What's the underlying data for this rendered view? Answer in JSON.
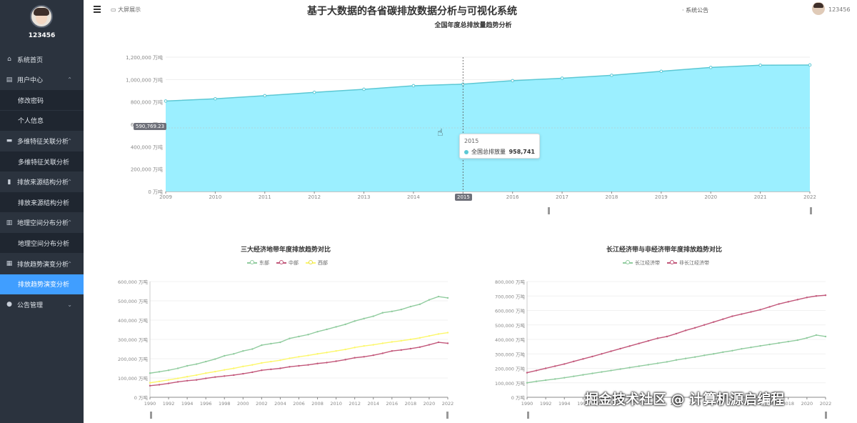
{
  "sidebar": {
    "user_name": "123456",
    "items": [
      {
        "label": "系统首页",
        "icon": "home-icon",
        "type": "top"
      },
      {
        "label": "用户中心",
        "icon": "user-center-icon",
        "type": "top",
        "arrow": "^"
      },
      {
        "label": "修改密码",
        "type": "sub"
      },
      {
        "label": "个人信息",
        "type": "sub"
      },
      {
        "label": "多维特征关联分析",
        "icon": "monitor-icon",
        "type": "top",
        "arrow": "^"
      },
      {
        "label": "多维特征关联分析",
        "type": "sub"
      },
      {
        "label": "排放来源结构分析",
        "icon": "clipboard-icon",
        "type": "top",
        "arrow": "^"
      },
      {
        "label": "排放来源结构分析",
        "type": "sub"
      },
      {
        "label": "地理空间分布分析",
        "icon": "bar-chart-icon",
        "type": "top",
        "arrow": "^"
      },
      {
        "label": "地理空间分布分析",
        "type": "sub"
      },
      {
        "label": "排放趋势演变分析",
        "icon": "grid-icon",
        "type": "top",
        "arrow": "^"
      },
      {
        "label": "排放趋势演变分析",
        "type": "sub",
        "active": true
      },
      {
        "label": "公告管理",
        "icon": "person-icon",
        "type": "top",
        "arrow": "v"
      }
    ]
  },
  "header": {
    "big_screen_label": "大屏展示",
    "title": "基于大数据的各省碳排放数据分析与可视化系统",
    "notice_label": "系统公告",
    "user_label": "123456"
  },
  "tooltip": {
    "year": "2015",
    "series": "全国总排放量",
    "value": "958,741"
  },
  "axis_pointer_label": "590,769.23",
  "watermark": "掘金技术社区 @ 计算机源启编程",
  "chart_data": [
    {
      "type": "area",
      "title": "全国年度总排放量趋势分析",
      "series": [
        {
          "name": "全国总排放量",
          "color": "#5cc8d4",
          "fill": "#9befff"
        }
      ],
      "x": [
        "2009",
        "2010",
        "2011",
        "2012",
        "2013",
        "2014",
        "2015",
        "2016",
        "2017",
        "2018",
        "2019",
        "2020",
        "2021",
        "2022"
      ],
      "values": [
        808000,
        828000,
        856000,
        886000,
        913000,
        945000,
        958741,
        990000,
        1012000,
        1038000,
        1074000,
        1108000,
        1128000,
        1130000
      ],
      "yticks": [
        "0 万吨",
        "200,000 万吨",
        "400,000 万吨",
        "600,000 万吨",
        "800,000 万吨",
        "1,000,000 万吨",
        "1,200,000 万吨"
      ],
      "ylim": [
        0,
        1200000
      ]
    },
    {
      "type": "line",
      "title": "三大经济地带年度排放趋势对比",
      "legend": [
        "东部",
        "中部",
        "西部"
      ],
      "colors": [
        "#91cc9f",
        "#c2577a",
        "#fcf76b"
      ],
      "x_start": 1990,
      "x_end": 2022,
      "xticks": [
        "1990",
        "1992",
        "1994",
        "1996",
        "1998",
        "2000",
        "2002",
        "2004",
        "2006",
        "2008",
        "2010",
        "2012",
        "2014",
        "2016",
        "2018",
        "2020",
        "2022"
      ],
      "yticks": [
        "0 万吨",
        "100,000 万吨",
        "200,000 万吨",
        "300,000 万吨",
        "400,000 万吨",
        "500,000 万吨",
        "600,000 万吨"
      ],
      "ylim": [
        0,
        600000
      ],
      "series": [
        {
          "name": "东部",
          "values": [
            125000,
            132000,
            140000,
            150000,
            163000,
            172000,
            185000,
            198000,
            215000,
            225000,
            240000,
            250000,
            270000,
            278000,
            285000,
            305000,
            315000,
            325000,
            340000,
            352000,
            365000,
            378000,
            395000,
            408000,
            420000,
            438000,
            445000,
            455000,
            470000,
            482000,
            505000,
            522000,
            515000
          ]
        },
        {
          "name": "中部",
          "values": [
            60000,
            65000,
            72000,
            80000,
            86000,
            90000,
            98000,
            105000,
            110000,
            115000,
            122000,
            130000,
            140000,
            145000,
            150000,
            158000,
            163000,
            168000,
            175000,
            180000,
            187000,
            195000,
            205000,
            210000,
            218000,
            228000,
            240000,
            245000,
            252000,
            260000,
            272000,
            285000,
            280000
          ]
        },
        {
          "name": "西部",
          "values": [
            75000,
            82000,
            90000,
            98000,
            107000,
            115000,
            125000,
            133000,
            142000,
            150000,
            160000,
            168000,
            178000,
            185000,
            192000,
            202000,
            210000,
            217000,
            225000,
            232000,
            240000,
            248000,
            258000,
            266000,
            272000,
            280000,
            287000,
            293000,
            300000,
            308000,
            318000,
            328000,
            335000
          ]
        }
      ]
    },
    {
      "type": "line",
      "title": "长江经济带与非经济带年度排放趋势对比",
      "legend": [
        "长江经济带",
        "非长江经济带"
      ],
      "colors": [
        "#91cc9f",
        "#c2577a"
      ],
      "x_start": 1990,
      "x_end": 2022,
      "xticks": [
        "1990",
        "1992",
        "1994",
        "1996",
        "1998",
        "2000",
        "2002",
        "2004",
        "2006",
        "2008",
        "2010",
        "2012",
        "2014",
        "2016",
        "2018",
        "2020",
        "2022"
      ],
      "yticks": [
        "0 万吨",
        "100,000 万吨",
        "200,000 万吨",
        "300,000 万吨",
        "400,000 万吨",
        "500,000 万吨",
        "600,000 万吨",
        "700,000 万吨",
        "800,000 万吨"
      ],
      "ylim": [
        0,
        800000
      ],
      "series": [
        {
          "name": "长江经济带",
          "values": [
            100000,
            110000,
            118000,
            126000,
            135000,
            145000,
            155000,
            165000,
            175000,
            185000,
            195000,
            205000,
            215000,
            225000,
            235000,
            245000,
            258000,
            268000,
            278000,
            290000,
            300000,
            312000,
            322000,
            335000,
            345000,
            355000,
            365000,
            375000,
            385000,
            395000,
            410000,
            430000,
            420000
          ]
        },
        {
          "name": "非长江经济带",
          "values": [
            170000,
            185000,
            200000,
            215000,
            230000,
            248000,
            265000,
            282000,
            300000,
            318000,
            336000,
            354000,
            372000,
            390000,
            408000,
            420000,
            440000,
            462000,
            480000,
            500000,
            520000,
            540000,
            560000,
            575000,
            590000,
            605000,
            625000,
            645000,
            660000,
            675000,
            690000,
            700000,
            705000
          ]
        }
      ]
    }
  ]
}
